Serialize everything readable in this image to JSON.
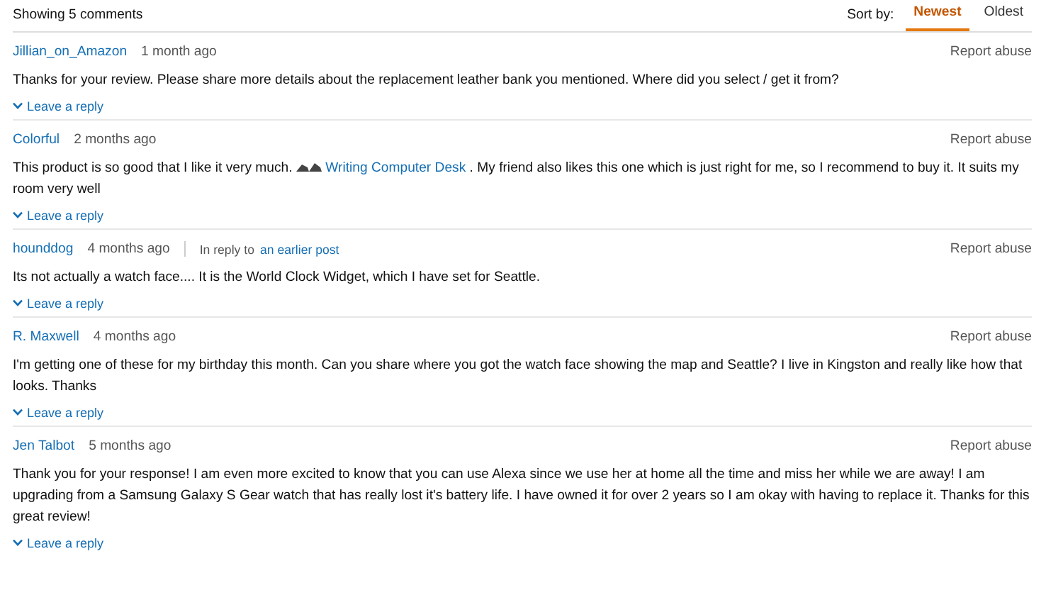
{
  "header": {
    "count": "Showing 5 comments",
    "sort_label": "Sort by:",
    "sort_options": [
      {
        "label": "Newest",
        "selected": true
      },
      {
        "label": "Oldest",
        "selected": false
      }
    ]
  },
  "comments": [
    {
      "author": "Jillian_on_Amazon",
      "time": "1 month ago",
      "report": "Report abuse",
      "body": [
        {
          "kind": "text",
          "text": "Thanks for your review. Please share more details about the replacement leather bank you mentioned. Where did you select / get it from?"
        }
      ],
      "reply": "Leave a reply"
    },
    {
      "author": "Colorful",
      "time": "2 months ago",
      "report": "Report abuse",
      "body": [
        {
          "kind": "text",
          "text": "This product is so good that I like it very much. "
        },
        {
          "kind": "icon"
        },
        {
          "kind": "link",
          "text": " Writing Computer Desk"
        },
        {
          "kind": "text",
          "text": " . My friend also likes this one which is just right for me, so I recommend to buy it. It suits my room very well"
        }
      ],
      "reply": "Leave a reply"
    },
    {
      "author": "hounddog",
      "time": "4 months ago",
      "reply_to_label": "In reply to",
      "reply_to_link": "an earlier post",
      "report": "Report abuse",
      "body": [
        {
          "kind": "text",
          "text": "Its not actually a watch face.... It is the World Clock Widget, which I have set for Seattle."
        }
      ],
      "reply": "Leave a reply"
    },
    {
      "author": "R. Maxwell",
      "time": "4 months ago",
      "report": "Report abuse",
      "body": [
        {
          "kind": "text",
          "text": "I'm getting one of these for my birthday this month. Can you share where you got the watch face showing the map and Seattle? I live in Kingston and really like how that looks. Thanks"
        }
      ],
      "reply": "Leave a reply"
    },
    {
      "author": "Jen Talbot",
      "time": "5 months ago",
      "report": "Report abuse",
      "body": [
        {
          "kind": "text",
          "text": "Thank you for your response! I am even more excited to know that you can use Alexa since we use her at home all the time and miss her while we are away! I am upgrading from a Samsung Galaxy S Gear watch that has really lost it's battery life. I have owned it for over 2 years so I am okay with having to replace it. Thanks for this great review!"
        }
      ],
      "reply": "Leave a reply"
    }
  ]
}
